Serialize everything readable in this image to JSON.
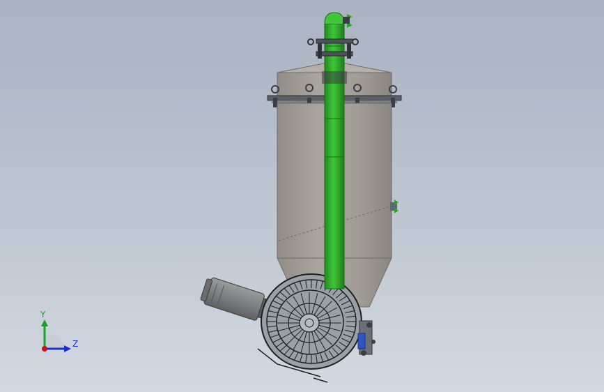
{
  "triad": {
    "y_label": "Y",
    "z_label": "Z",
    "colors": {
      "y": "#16a32a",
      "z": "#1a2fd6",
      "origin": "#d01010"
    }
  },
  "colors": {
    "background_top": "#a9b3c2",
    "background_bottom": "#d3d9e1",
    "tank_body": "#a49e98",
    "tank_shade": "#8f8a85",
    "pipe": "#34b52e",
    "pipe_dark": "#1f8a1c",
    "motor": "#7f8183",
    "flange": "#5a5f66"
  },
  "icons": [
    "coordinate-triad-icon"
  ]
}
